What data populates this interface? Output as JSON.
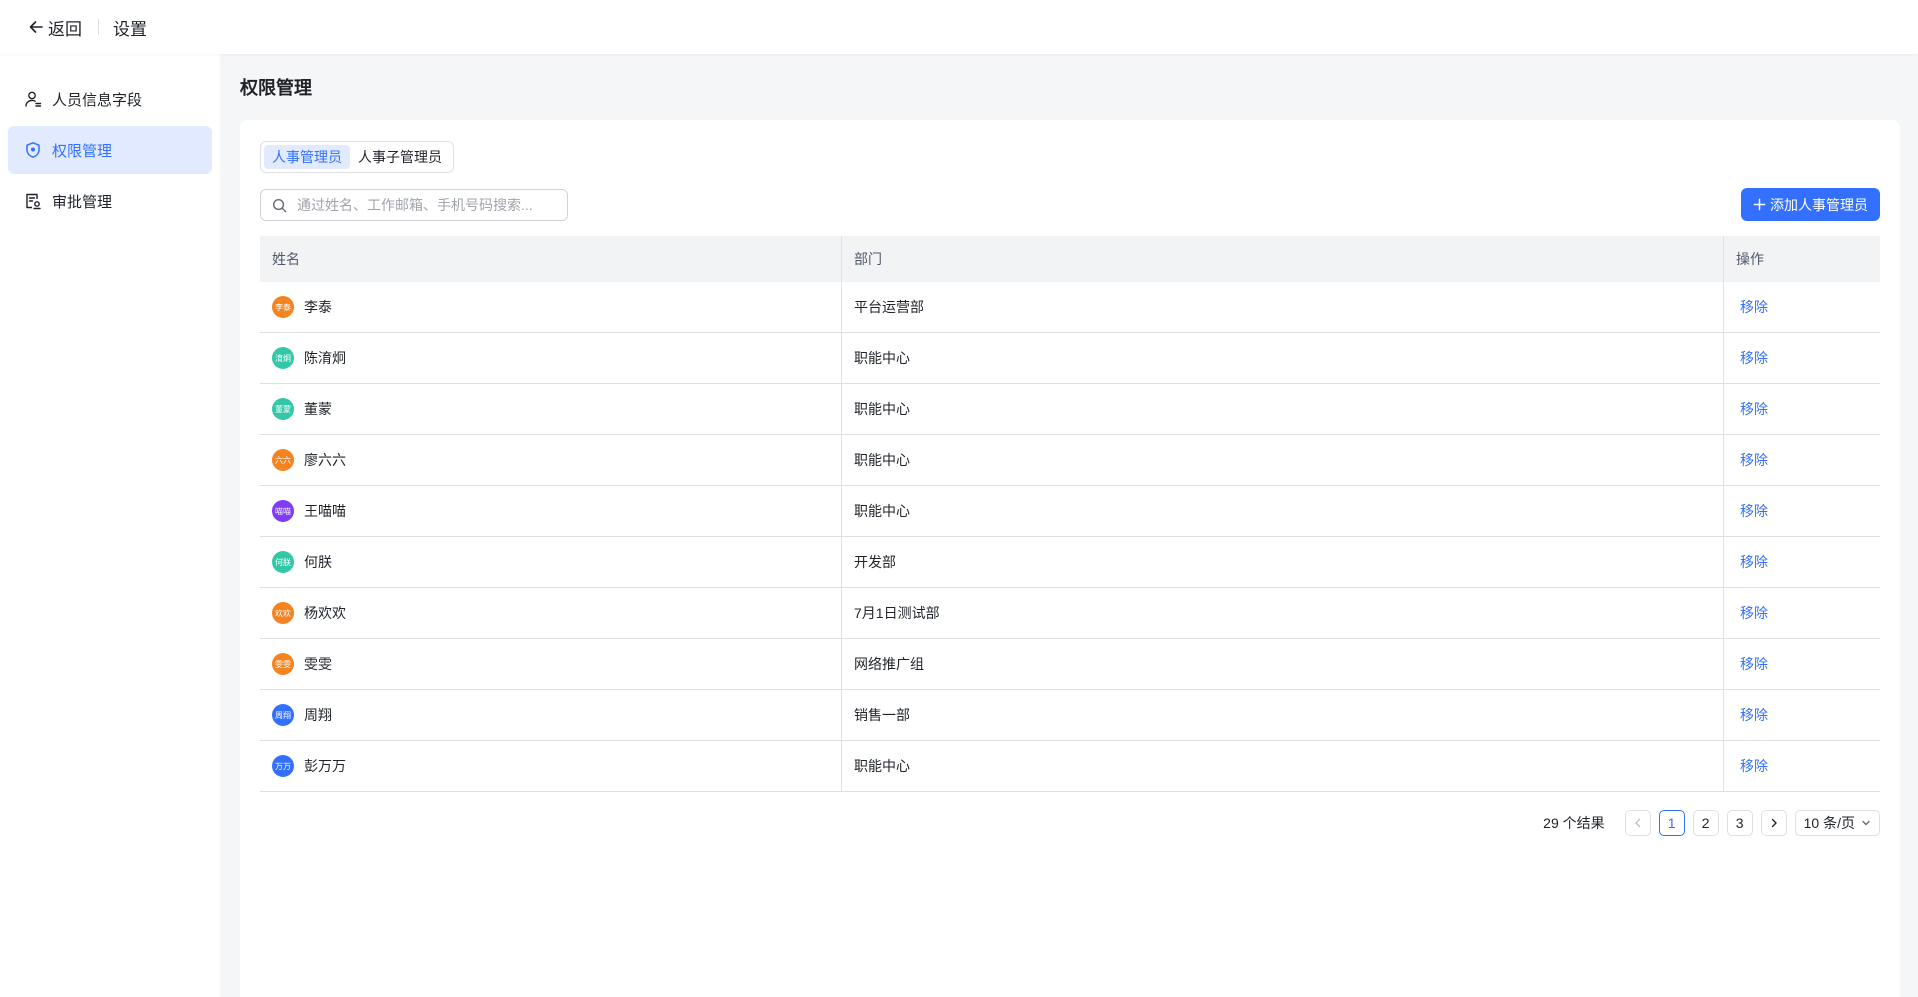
{
  "header": {
    "back_label": "返回",
    "title": "设置"
  },
  "sidebar": {
    "items": [
      {
        "label": "人员信息字段",
        "icon": "person-field-icon"
      },
      {
        "label": "权限管理",
        "icon": "shield-icon",
        "active": true
      },
      {
        "label": "审批管理",
        "icon": "approval-doc-icon"
      }
    ]
  },
  "page": {
    "title": "权限管理"
  },
  "tabs": [
    {
      "label": "人事管理员",
      "active": true
    },
    {
      "label": "人事子管理员",
      "active": false
    }
  ],
  "search": {
    "placeholder": "通过姓名、工作邮箱、手机号码搜索..."
  },
  "add_button": {
    "label": "添加人事管理员"
  },
  "table": {
    "columns": [
      "姓名",
      "部门",
      "操作"
    ],
    "action_label": "移除",
    "rows": [
      {
        "name": "李泰",
        "avatar": "李泰",
        "avatar_color": "#f5831f",
        "dept": "平台运营部"
      },
      {
        "name": "陈淯炯",
        "avatar": "淯炯",
        "avatar_color": "#33c7a8",
        "dept": "职能中心"
      },
      {
        "name": "董蒙",
        "avatar": "董蒙",
        "avatar_color": "#33c7a8",
        "dept": "职能中心"
      },
      {
        "name": "廖六六",
        "avatar": "六六",
        "avatar_color": "#f5831f",
        "dept": "职能中心"
      },
      {
        "name": "王喵喵",
        "avatar": "喵喵",
        "avatar_color": "#7f3bf5",
        "dept": "职能中心"
      },
      {
        "name": "何朕",
        "avatar": "何朕",
        "avatar_color": "#33c7a8",
        "dept": "开发部"
      },
      {
        "name": "杨欢欢",
        "avatar": "欢欢",
        "avatar_color": "#f5831f",
        "dept": "7月1日测试部"
      },
      {
        "name": "雯雯",
        "avatar": "雯雯",
        "avatar_color": "#f5831f",
        "dept": "网络推广组"
      },
      {
        "name": "周翔",
        "avatar": "周翔",
        "avatar_color": "#3370ff",
        "dept": "销售一部"
      },
      {
        "name": "彭万万",
        "avatar": "万万",
        "avatar_color": "#3370ff",
        "dept": "职能中心"
      }
    ]
  },
  "pagination": {
    "total_label": "29 个结果",
    "pages": [
      "1",
      "2",
      "3"
    ],
    "current": "1",
    "page_size_label": "10 条/页"
  },
  "colors": {
    "accent": "#3370ff",
    "active_bg": "#e1eaff"
  }
}
